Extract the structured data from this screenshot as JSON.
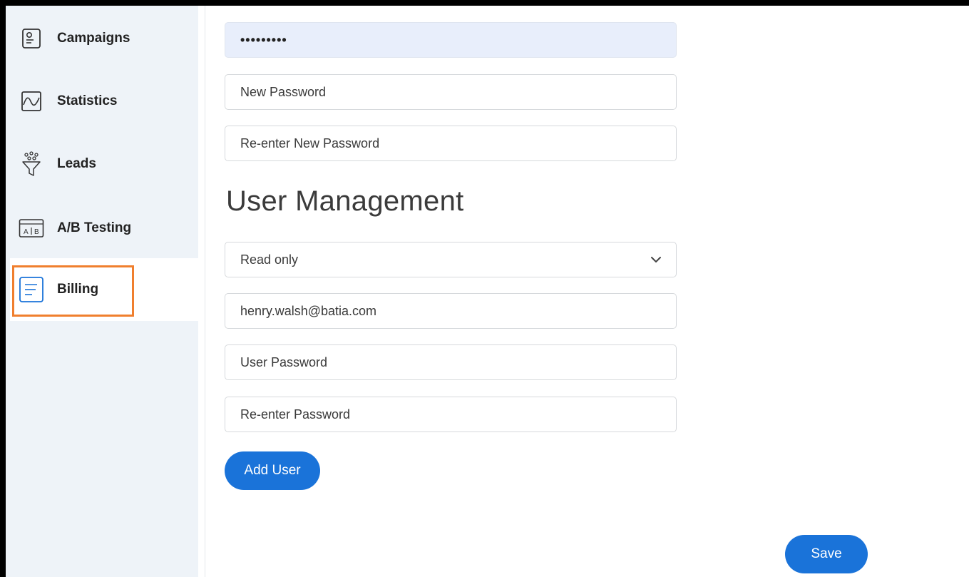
{
  "sidebar": {
    "items": [
      {
        "label": "Campaigns",
        "icon": "campaigns-icon"
      },
      {
        "label": "Statistics",
        "icon": "statistics-icon"
      },
      {
        "label": "Leads",
        "icon": "leads-funnel-icon"
      },
      {
        "label": "A/B Testing",
        "icon": "ab-testing-icon"
      },
      {
        "label": "Billing",
        "icon": "billing-icon",
        "active": true
      }
    ],
    "highlight_color": "#f07f2e"
  },
  "password_section": {
    "current_password_value": "•••••••••",
    "new_password_placeholder": "New Password",
    "reenter_new_password_placeholder": "Re-enter New Password"
  },
  "user_management": {
    "title": "User Management",
    "role_select_value": "Read only",
    "email_value": "henry.walsh@batia.com",
    "user_password_placeholder": "User Password",
    "reenter_password_placeholder": "Re-enter Password",
    "add_user_label": "Add User"
  },
  "footer": {
    "save_label": "Save"
  },
  "colors": {
    "accent": "#1a73d9",
    "sidebar_bg": "#eef3f8",
    "filled_field_bg": "#e8eefb"
  }
}
